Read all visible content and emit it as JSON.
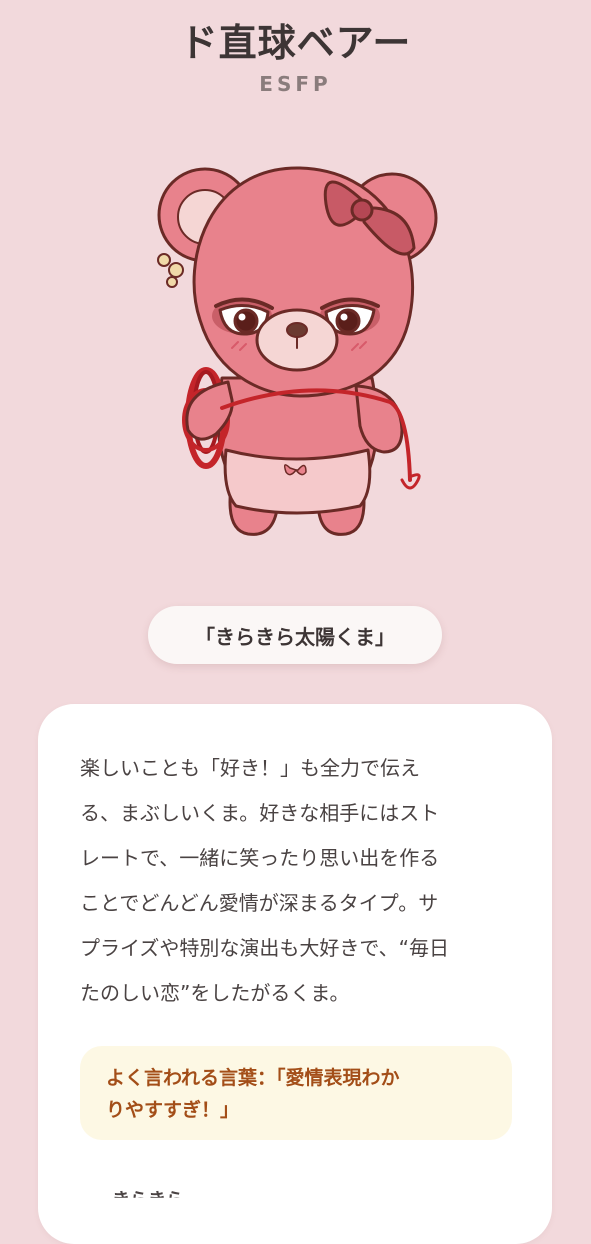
{
  "header": {
    "title": "ド直球ベアー",
    "type_code": "ESFP"
  },
  "character": {
    "nickname": "「きらきら太陽くま」",
    "illustration": "pink-bear-holding-red-rope"
  },
  "card": {
    "description": "楽しいことも「好き！」も全力で伝え\nる、まぶしいくま。好きな相手にはスト\nレートで、一緒に笑ったり思い出を作る\nことでどんどん愛情が深まるタイプ。サ\nプライズや特別な演出も大好きで、“毎日\nたのしい恋”をしたがるくま。",
    "quote": "よく言われる言葉：「愛情表現わか\nりやすすぎ！」",
    "next_section_peek": "きらきら"
  },
  "colors": {
    "background": "#f2d9dc",
    "card": "#ffffff",
    "quote_bg": "#fdf8e4",
    "quote_text": "#a34e18",
    "bear_body": "#e8828c",
    "bear_outline": "#6b2a26",
    "rope": "#c4252a"
  }
}
